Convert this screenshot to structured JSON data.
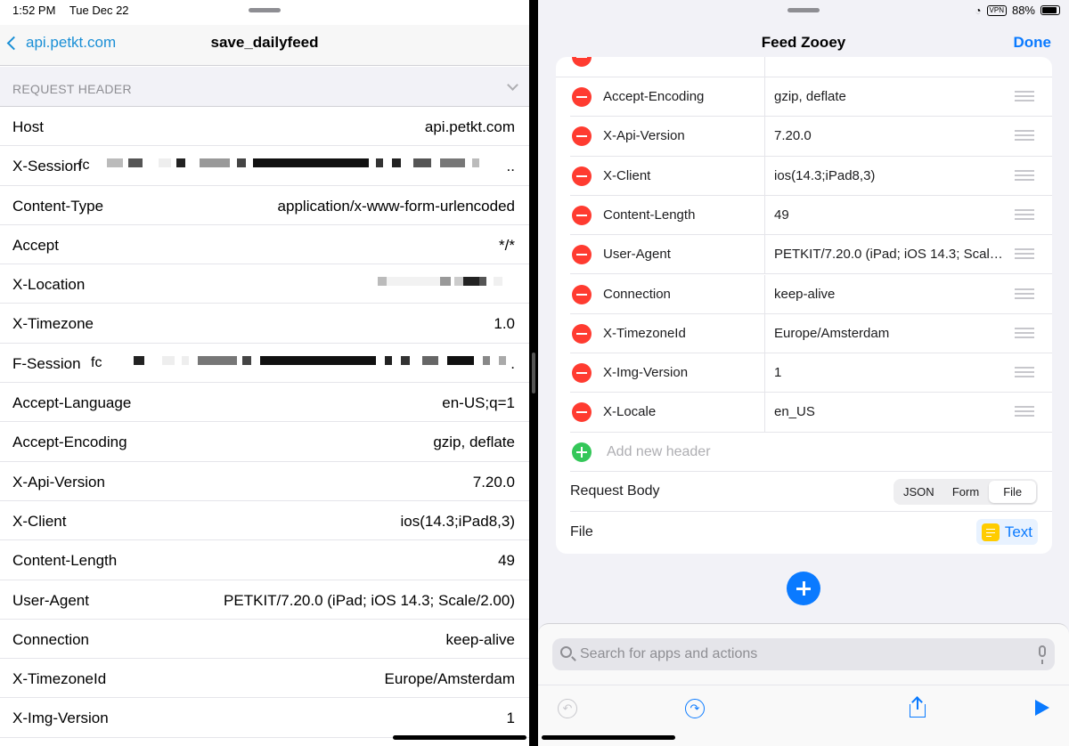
{
  "status_bar": {
    "time": "1:52 PM",
    "date": "Tue Dec 22",
    "vpn": "VPN",
    "battery": "88%",
    "battery_level": 0.88
  },
  "left": {
    "back_label": "api.petkt.com",
    "title": "save_dailyfeed",
    "section_label": "REQUEST HEADER",
    "rows": [
      {
        "key": "Host",
        "value": "api.petkt.com"
      },
      {
        "key": "X-Session",
        "value": "fc"
      },
      {
        "key": "Content-Type",
        "value": "application/x-www-form-urlencoded"
      },
      {
        "key": "Accept",
        "value": "*/*"
      },
      {
        "key": "X-Location",
        "value": ""
      },
      {
        "key": "X-Timezone",
        "value": "1.0"
      },
      {
        "key": "F-Session",
        "value": "fc"
      },
      {
        "key": "Accept-Language",
        "value": "en-US;q=1"
      },
      {
        "key": "Accept-Encoding",
        "value": "gzip, deflate"
      },
      {
        "key": "X-Api-Version",
        "value": "7.20.0"
      },
      {
        "key": "X-Client",
        "value": "ios(14.3;iPad8,3)"
      },
      {
        "key": "Content-Length",
        "value": "49"
      },
      {
        "key": "User-Agent",
        "value": "PETKIT/7.20.0 (iPad; iOS 14.3; Scale/2.00)"
      },
      {
        "key": "Connection",
        "value": "keep-alive"
      },
      {
        "key": "X-TimezoneId",
        "value": "Europe/Amsterdam"
      },
      {
        "key": "X-Img-Version",
        "value": "1"
      }
    ]
  },
  "right": {
    "title": "Feed Zooey",
    "done_label": "Done",
    "headers": [
      {
        "key": "Accept-Encoding",
        "value": "gzip, deflate"
      },
      {
        "key": "X-Api-Version",
        "value": "7.20.0"
      },
      {
        "key": "X-Client",
        "value": "ios(14.3;iPad8,3)"
      },
      {
        "key": "Content-Length",
        "value": "49"
      },
      {
        "key": "User-Agent",
        "value": "PETKIT/7.20.0 (iPad; iOS 14.3; Scale..."
      },
      {
        "key": "Connection",
        "value": "keep-alive"
      },
      {
        "key": "X-TimezoneId",
        "value": "Europe/Amsterdam"
      },
      {
        "key": "X-Img-Version",
        "value": "1"
      },
      {
        "key": "X-Locale",
        "value": "en_US"
      }
    ],
    "add_header_placeholder": "Add new header",
    "request_body_label": "Request Body",
    "body_segments": [
      "JSON",
      "Form",
      "File"
    ],
    "body_selected": "File",
    "file_label": "File",
    "file_value": "Text",
    "search_placeholder": "Search for apps and actions"
  },
  "colors": {
    "accent": "#0a7aff",
    "link": "#1a8fd6",
    "delete": "#ff3b30",
    "add": "#34c759",
    "text_icon": "#ffcc00"
  }
}
